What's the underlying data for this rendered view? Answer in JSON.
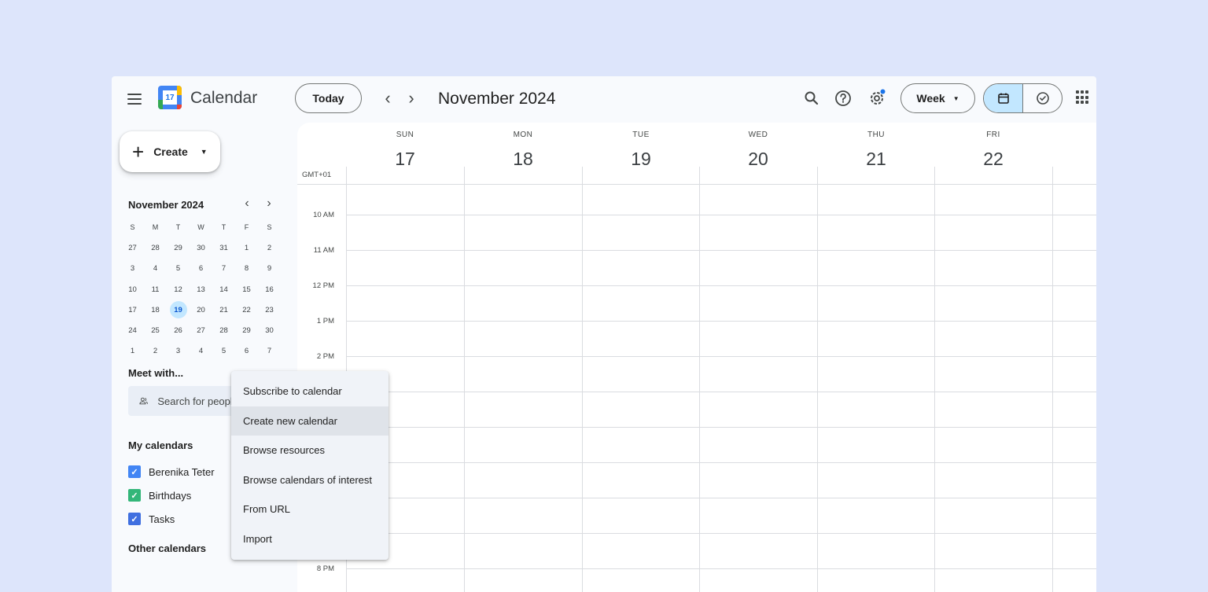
{
  "header": {
    "app_title": "Calendar",
    "logo_day": "17",
    "today_label": "Today",
    "month_title": "November 2024",
    "view_label": "Week"
  },
  "sidebar": {
    "create_label": "Create",
    "mini_calendar": {
      "title": "November 2024",
      "dow": [
        "S",
        "M",
        "T",
        "W",
        "T",
        "F",
        "S"
      ],
      "weeks": [
        [
          "27",
          "28",
          "29",
          "30",
          "31",
          "1",
          "2"
        ],
        [
          "3",
          "4",
          "5",
          "6",
          "7",
          "8",
          "9"
        ],
        [
          "10",
          "11",
          "12",
          "13",
          "14",
          "15",
          "16"
        ],
        [
          "17",
          "18",
          "19",
          "20",
          "21",
          "22",
          "23"
        ],
        [
          "24",
          "25",
          "26",
          "27",
          "28",
          "29",
          "30"
        ],
        [
          "1",
          "2",
          "3",
          "4",
          "5",
          "6",
          "7"
        ]
      ],
      "selected": "19"
    },
    "meet_title": "Meet with...",
    "search_people_placeholder": "Search for people",
    "my_calendars_title": "My calendars",
    "calendars": [
      {
        "name": "Berenika Teter",
        "color": "#4285f4",
        "checked": true
      },
      {
        "name": "Birthdays",
        "color": "#33b679",
        "checked": true
      },
      {
        "name": "Tasks",
        "color": "#3f6fe0",
        "checked": true
      }
    ],
    "other_calendars_title": "Other calendars"
  },
  "week": {
    "timezone": "GMT+01",
    "days": [
      {
        "dow": "SUN",
        "date": "17"
      },
      {
        "dow": "MON",
        "date": "18"
      },
      {
        "dow": "TUE",
        "date": "19"
      },
      {
        "dow": "WED",
        "date": "20"
      },
      {
        "dow": "THU",
        "date": "21"
      },
      {
        "dow": "FRI",
        "date": "22"
      }
    ],
    "time_labels": [
      "10 AM",
      "11 AM",
      "12 PM",
      "1 PM",
      "2 PM",
      "8 PM"
    ]
  },
  "dropdown": {
    "items": [
      "Subscribe to calendar",
      "Create new calendar",
      "Browse resources",
      "Browse calendars of interest",
      "From URL",
      "Import"
    ],
    "highlighted_index": 1
  },
  "colors": {
    "background": "#dde5fb",
    "accent": "#0b57d0",
    "selected_chip": "#c2e7ff"
  }
}
